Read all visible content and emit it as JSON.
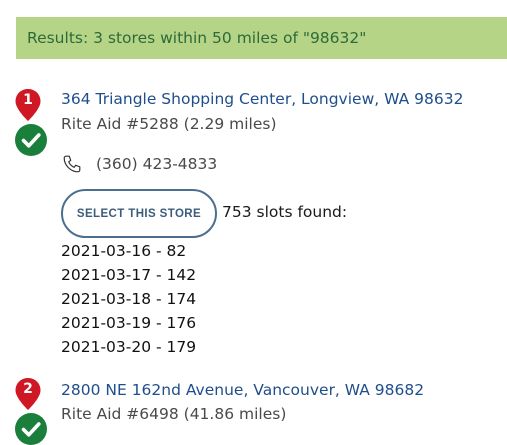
{
  "results_banner": "Results: 3 stores within 50 miles of \"98632\"",
  "colors": {
    "banner_bg": "#b6d486",
    "banner_text": "#2d6a3b",
    "address_link": "#1f4e8c",
    "pin_red": "#d01825",
    "check_green": "#1a7f3a",
    "button_border": "#4d6f8f"
  },
  "stores": [
    {
      "marker": "1",
      "address": "364 Triangle Shopping Center, Longview, WA 98632",
      "name": "Rite Aid #5288 (2.29 miles)",
      "phone": "(360) 423-4833",
      "select_label": "SELECT THIS STORE",
      "slots_found": "753 slots found:",
      "slots": [
        "2021-03-16 - 82",
        "2021-03-17 - 142",
        "2021-03-18 - 174",
        "2021-03-19 - 176",
        "2021-03-20 - 179"
      ],
      "icons": [
        "map-pin-icon",
        "checkmark-icon",
        "phone-icon"
      ]
    },
    {
      "marker": "2",
      "address": "2800 NE 162nd Avenue, Vancouver, WA 98682",
      "name": "Rite Aid #6498 (41.86 miles)",
      "icons": [
        "map-pin-icon",
        "checkmark-icon"
      ]
    }
  ]
}
